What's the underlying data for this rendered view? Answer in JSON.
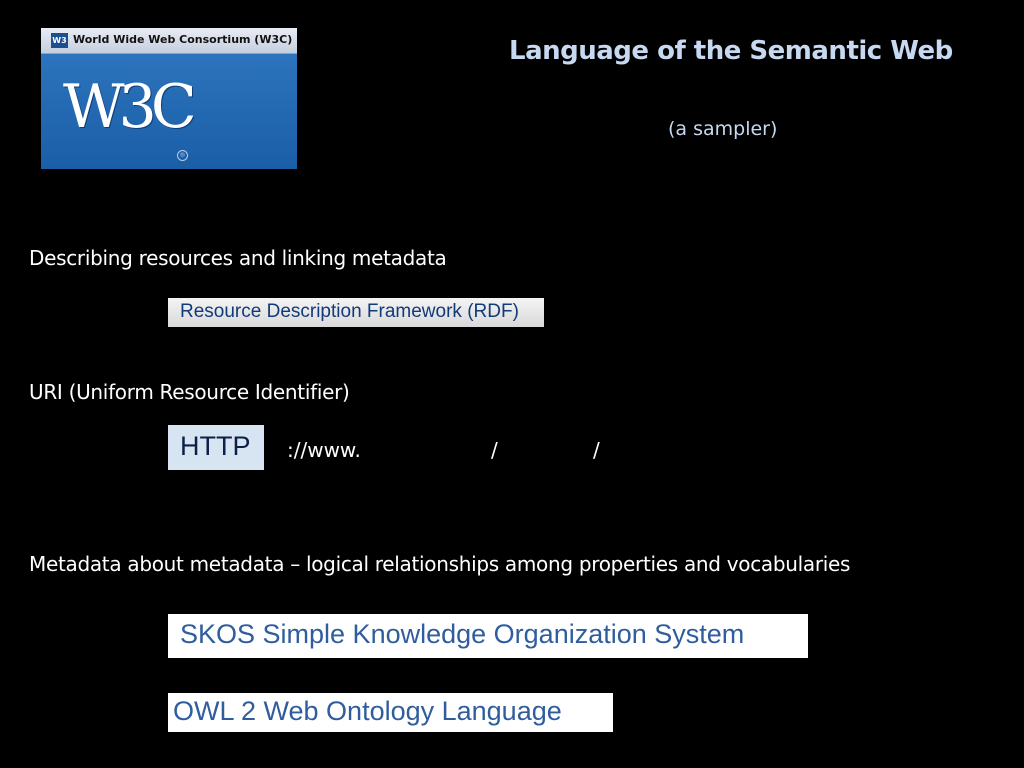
{
  "logo": {
    "bar_text": "World Wide Web Consortium (W3C)",
    "bar_icon": "W3",
    "mark": "W3C",
    "registered": "®"
  },
  "title": "Language of the Semantic Web",
  "subtitle": "(a sampler)",
  "sections": {
    "describing": "Describing resources and linking metadata",
    "rdf_label": "Resource Description Framework (RDF)",
    "uri": "URI (Uniform Resource Identifier)",
    "http_label": "HTTP",
    "uri_www": "://www.",
    "uri_slash1": "/",
    "uri_slash2": "/",
    "metadata": "Metadata about metadata – logical relationships among properties and vocabularies",
    "skos_label": "SKOS Simple Knowledge Organization System",
    "owl_label": "OWL 2 Web Ontology Language"
  },
  "colors": {
    "background": "#000000",
    "title": "#c6d9f1",
    "logo_blue": "#1f5fa6",
    "label_blue": "#2f5d9e"
  }
}
